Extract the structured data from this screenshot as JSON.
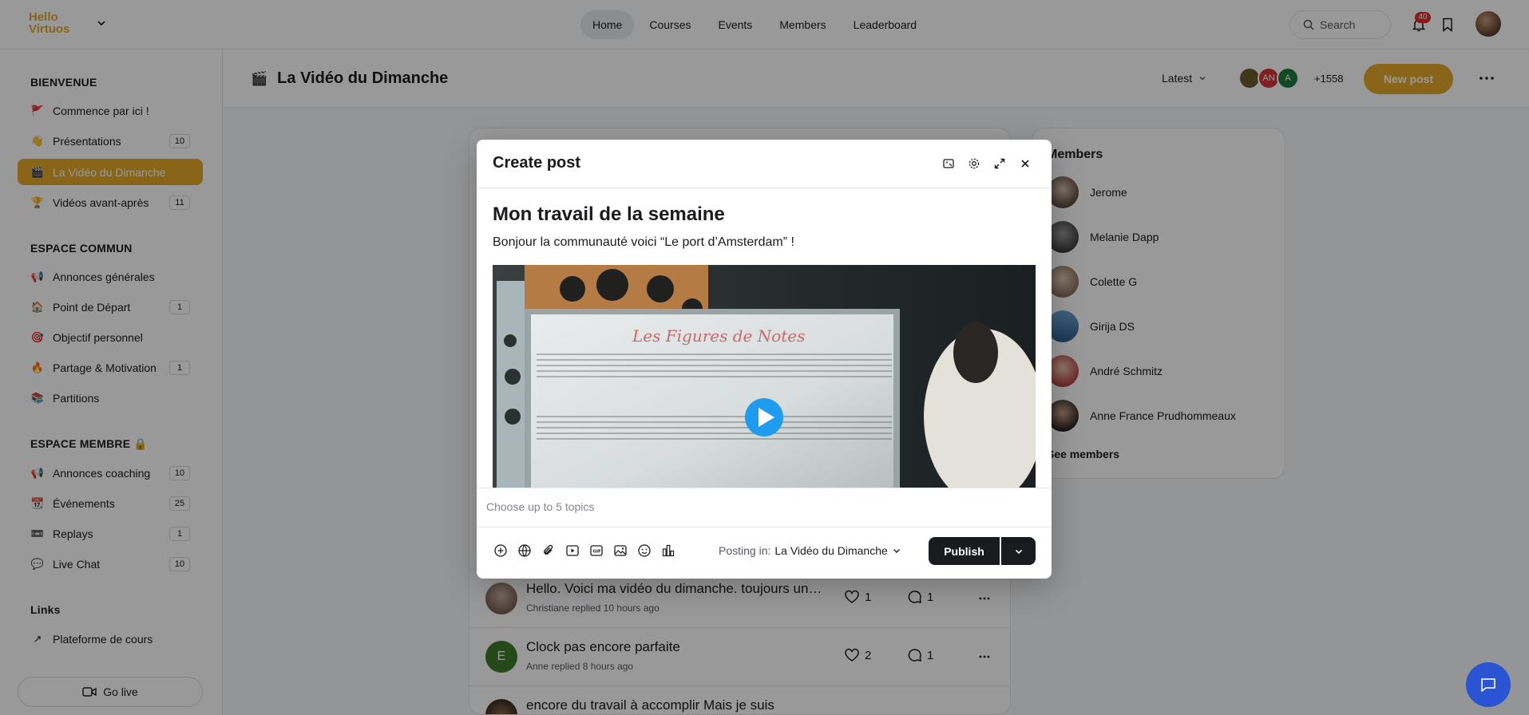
{
  "app": {
    "logo_line1": "Hello",
    "logo_line2": "Virtuos"
  },
  "nav": {
    "items": [
      "Home",
      "Courses",
      "Events",
      "Members",
      "Leaderboard"
    ],
    "search_placeholder": "Search",
    "notification_count": "40"
  },
  "sidebar": {
    "sections": [
      {
        "title": "BIENVENUE"
      },
      {
        "title": "ESPACE COMMUN"
      },
      {
        "title": "ESPACE MEMBRE 🔒"
      },
      {
        "title": "Links"
      }
    ],
    "items": [
      {
        "label": "Commence par ici !",
        "icon": "🚩",
        "count": ""
      },
      {
        "label": "Présentations",
        "icon": "👋",
        "count": "10"
      },
      {
        "label": "La Vidéo du Dimanche",
        "icon": "🎬",
        "count": ""
      },
      {
        "label": "Vidéos avant-après",
        "icon": "🏆",
        "count": "11"
      },
      {
        "label": "Annonces générales",
        "icon": "📢",
        "count": ""
      },
      {
        "label": "Point de Départ",
        "icon": "🏠",
        "count": "1"
      },
      {
        "label": "Objectif personnel",
        "icon": "🎯",
        "count": ""
      },
      {
        "label": "Partage & Motivation",
        "icon": "🔥",
        "count": "1"
      },
      {
        "label": "Partitions",
        "icon": "📚",
        "count": ""
      },
      {
        "label": "Annonces coaching",
        "icon": "📢",
        "count": "10"
      },
      {
        "label": "Événements",
        "icon": "📆",
        "count": "25"
      },
      {
        "label": "Replays",
        "icon": "📼",
        "count": "1"
      },
      {
        "label": "Live Chat",
        "icon": "💬",
        "count": "10"
      },
      {
        "label": "Plateforme de cours",
        "icon": "↗",
        "count": ""
      }
    ],
    "go_live": "Go live"
  },
  "header": {
    "title": "La Vidéo du Dimanche",
    "title_icon": "🎬",
    "sort": "Latest",
    "member_initials": [
      "",
      "AN",
      "A"
    ],
    "member_count": "+1558",
    "new_post": "New post"
  },
  "feed": {
    "posts": [
      {
        "title": "Hello.  Voici ma vidéo  du dimanche. toujours un…",
        "meta": "Christiane replied 10 hours ago",
        "likes": "1",
        "comments": "1",
        "avatar_initial": ""
      },
      {
        "title": "Clock pas encore parfaite",
        "meta": "Anne replied 8 hours ago",
        "likes": "2",
        "comments": "1",
        "avatar_initial": "E"
      },
      {
        "title": "encore du travail à accomplir Mais je suis",
        "meta": "",
        "likes": "",
        "comments": "",
        "avatar_initial": ""
      }
    ]
  },
  "members_panel": {
    "title": "Members",
    "members": [
      "Jerome",
      "Melanie Dapp",
      "Colette G",
      "Girija DS",
      "André Schmitz",
      "Anne France Prudhommeaux"
    ],
    "see_all": "See members"
  },
  "modal": {
    "title": "Create post",
    "post_title": "Mon travail de la semaine",
    "post_body": "Bonjour la communauté voici “Le port d’Amsterdam” !",
    "video_whiteboard_text": "Les Figures de Notes",
    "topics_placeholder": "Choose up to 5 topics",
    "posting_in_label": "Posting in:",
    "posting_in_space": "La Vidéo du Dimanche",
    "publish": "Publish"
  },
  "colors": {
    "accent": "#e3a92b",
    "dark": "#191b1f",
    "chat": "#2b54d4",
    "badge": "#e22d2d"
  }
}
